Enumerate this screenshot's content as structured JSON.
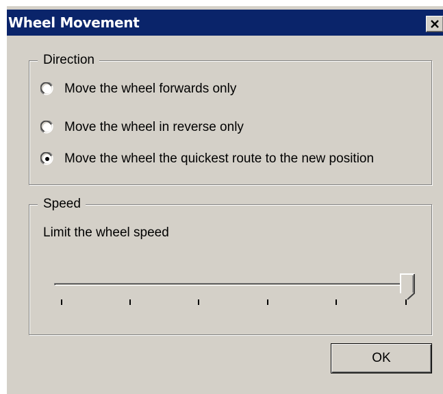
{
  "window": {
    "title": "Wheel Movement",
    "close_glyph": "close-icon"
  },
  "direction": {
    "label": "Direction",
    "options": [
      {
        "label": "Move the wheel forwards only",
        "selected": false
      },
      {
        "label": "Move the wheel in reverse only",
        "selected": false
      },
      {
        "label": "Move the wheel the quickest route to the new position",
        "selected": true
      }
    ]
  },
  "speed": {
    "label": "Speed",
    "description": "Limit the wheel speed",
    "slider": {
      "value_fraction": 1.0,
      "tick_count": 6
    }
  },
  "buttons": {
    "ok_label": "OK"
  },
  "colors": {
    "titlebar": "#0a246a",
    "face": "#d4d0c8"
  }
}
